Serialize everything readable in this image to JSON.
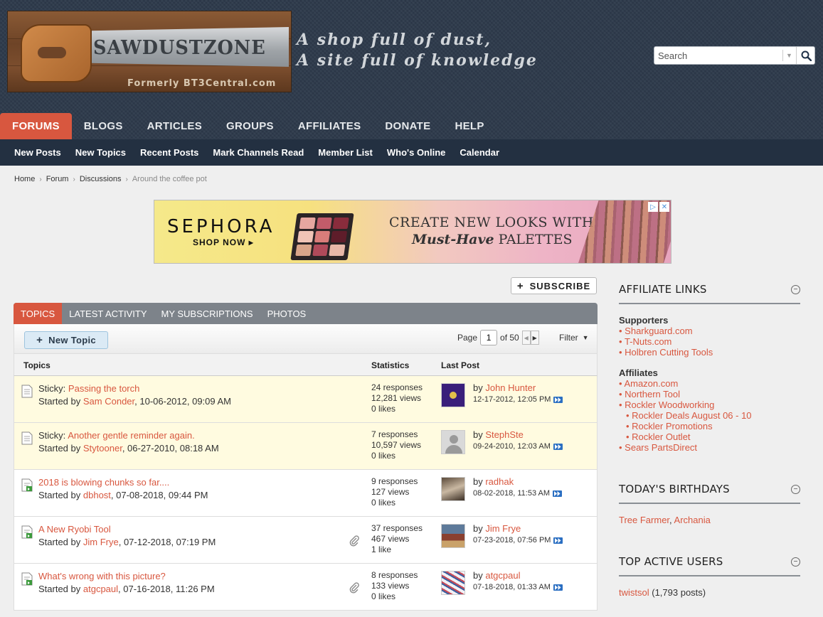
{
  "site": {
    "logo_text": "SAWDUSTZONE",
    "logo_sub": "Formerly BT3Central.com",
    "tagline_line1": "A shop full of dust,",
    "tagline_line2": "A site full of knowledge"
  },
  "search": {
    "placeholder": "Search"
  },
  "nav": {
    "main": [
      "FORUMS",
      "BLOGS",
      "ARTICLES",
      "GROUPS",
      "AFFILIATES",
      "DONATE",
      "HELP"
    ],
    "active_index": 0,
    "sub": [
      "New Posts",
      "New Topics",
      "Recent Posts",
      "Mark Channels Read",
      "Member List",
      "Who's Online",
      "Calendar"
    ]
  },
  "breadcrumb": [
    "Home",
    "Forum",
    "Discussions",
    "Around the coffee pot"
  ],
  "ad": {
    "brand": "SEPHORA",
    "cta": "SHOP NOW ▸",
    "line1": "CREATE NEW LOOKS WITH",
    "line2_em": "Must-Have",
    "line2_rest": " PALETTES"
  },
  "subscribe_label": "SUBSCRIBE",
  "tabs": [
    "TOPICS",
    "LATEST ACTIVITY",
    "MY SUBSCRIPTIONS",
    "PHOTOS"
  ],
  "toolbar": {
    "new_topic_label": "New Topic",
    "page_label": "Page",
    "page_value": "1",
    "page_total": "of 50",
    "filter_label": "Filter"
  },
  "table_headers": {
    "topics": "Topics",
    "statistics": "Statistics",
    "last_post": "Last Post"
  },
  "topics": [
    {
      "sticky": true,
      "prefix": "Sticky:",
      "title": "Passing the torch",
      "started_by": "Sam Conder",
      "started_date": ", 10-06-2012, 09:09 AM",
      "responses": "24 responses",
      "views": "12,281 views",
      "likes": "0 likes",
      "attachment": false,
      "last_by": "John Hunter",
      "last_date": "12-17-2012, 12:05 PM",
      "avatar": "flag"
    },
    {
      "sticky": true,
      "prefix": "Sticky:",
      "title": "Another gentle reminder again.",
      "started_by": "Stytooner",
      "started_date": ", 06-27-2010, 08:18 AM",
      "responses": "7 responses",
      "views": "10,597 views",
      "likes": "0 likes",
      "attachment": false,
      "last_by": "StephSte",
      "last_date": "09-24-2010, 12:03 AM",
      "avatar": "default"
    },
    {
      "sticky": false,
      "prefix": "",
      "title": "2018 is blowing chunks so far....",
      "started_by": "dbhost",
      "started_date": ", 07-08-2018, 09:44 PM",
      "responses": "9 responses",
      "views": "127 views",
      "likes": "0 likes",
      "attachment": false,
      "last_by": "radhak",
      "last_date": "08-02-2018, 11:53 AM",
      "avatar": "photo1"
    },
    {
      "sticky": false,
      "prefix": "",
      "title": "A New Ryobi Tool",
      "started_by": "Jim Frye",
      "started_date": ", 07-12-2018, 07:19 PM",
      "responses": "37 responses",
      "views": "467 views",
      "likes": "1 like",
      "attachment": true,
      "last_by": "Jim Frye",
      "last_date": "07-23-2018, 07:56 PM",
      "avatar": "photo2"
    },
    {
      "sticky": false,
      "prefix": "",
      "title": "What's wrong with this picture?",
      "started_by": "atgcpaul",
      "started_date": ", 07-16-2018, 11:26 PM",
      "responses": "8 responses",
      "views": "133 views",
      "likes": "0 likes",
      "attachment": true,
      "last_by": "atgcpaul",
      "last_date": "07-18-2018, 01:33 AM",
      "avatar": "photo3"
    }
  ],
  "sidebar": {
    "affiliate_title": "AFFILIATE LINKS",
    "supporters_label": "Supporters",
    "supporters": [
      "Sharkguard.com",
      "T-Nuts.com",
      "Holbren Cutting Tools"
    ],
    "affiliates_label": "Affiliates",
    "affiliates": [
      {
        "label": "Amazon.com",
        "indent": false
      },
      {
        "label": "Northern Tool",
        "indent": false
      },
      {
        "label": "Rockler Woodworking",
        "indent": false
      },
      {
        "label": "Rockler Deals August 06 - 10",
        "indent": true
      },
      {
        "label": "Rockler Promotions",
        "indent": true
      },
      {
        "label": "Rockler Outlet",
        "indent": true
      },
      {
        "label": "Sears PartsDirect",
        "indent": false
      }
    ],
    "birthdays_title": "TODAY'S BIRTHDAYS",
    "birthdays": [
      "Tree Farmer",
      "Archania"
    ],
    "top_users_title": "TOP ACTIVE USERS",
    "top_user_name": "twistsol",
    "top_user_posts": "(1,793 posts)"
  },
  "colors": {
    "accent": "#d8573f",
    "header_bg": "#2d3a4b",
    "subnav_bg": "#233041",
    "tabbar_bg": "#7d838a",
    "sticky_bg": "#fffbe0"
  }
}
